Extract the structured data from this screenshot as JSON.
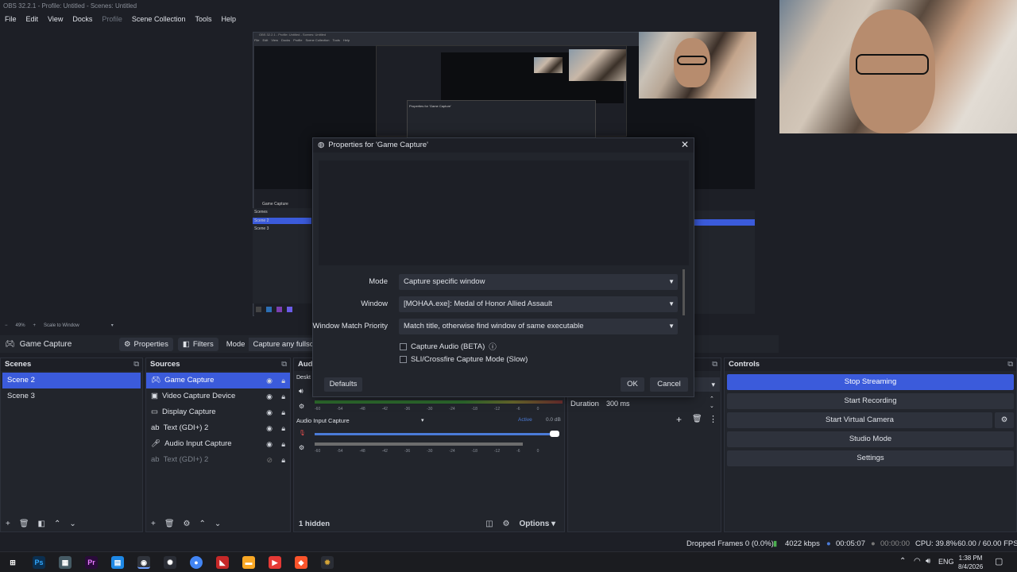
{
  "window": {
    "title": "OBS 32.2.1 - Profile: Untitled - Scenes: Untitled"
  },
  "menu": [
    "File",
    "Edit",
    "View",
    "Docks",
    "Profile",
    "Scene Collection",
    "Tools",
    "Help"
  ],
  "preview": {
    "zoom": "49%",
    "scale": "Scale to Window",
    "nested": {
      "title": "OBS 32.2.1 - Profile: Untitled - Scenes: Untitled",
      "menu": [
        "File",
        "Edit",
        "View",
        "Docks",
        "Profile",
        "Scene Collection",
        "Tools",
        "Help"
      ],
      "dialog_title": "Properties for 'Game Capture'",
      "source": "Game Capture",
      "scenes_header": "Scenes",
      "scenes": [
        "Scene 2",
        "Scene 3"
      ]
    }
  },
  "source_toolbar": {
    "source_name": "Game Capture",
    "properties_label": "Properties",
    "filters_label": "Filters",
    "mode_label": "Mode",
    "mode_value": "Capture any fullscre"
  },
  "scenes": {
    "header": "Scenes",
    "items": [
      "Scene 2",
      "Scene 3"
    ]
  },
  "sources": {
    "header": "Sources",
    "items": [
      {
        "name": "Game Capture",
        "icon": "gamepad-icon"
      },
      {
        "name": "Video Capture Device",
        "icon": "camera-icon"
      },
      {
        "name": "Display Capture",
        "icon": "monitor-icon"
      },
      {
        "name": "Text (GDI+) 2",
        "icon": "text-icon"
      },
      {
        "name": "Audio Input Capture",
        "icon": "mic-icon"
      },
      {
        "name": "Text (GDI+) 2",
        "icon": "text-icon"
      }
    ]
  },
  "audio": {
    "header": "Audi",
    "desktop_label": "Deskt",
    "input_name": "Audio Input Capture",
    "input_status": "Active",
    "input_db": "0.0 dB",
    "ticks": [
      "-60",
      "-54",
      "-48",
      "-42",
      "-36",
      "-30",
      "-24",
      "-18",
      "-12",
      "-6",
      "0"
    ],
    "hidden_label": "1 hidden",
    "options_label": "Options"
  },
  "transitions": {
    "duration_label": "Duration",
    "duration_value": "300 ms"
  },
  "controls": {
    "header": "Controls",
    "stop_streaming": "Stop Streaming",
    "start_recording": "Start Recording",
    "start_virtual_camera": "Start Virtual Camera",
    "studio_mode": "Studio Mode",
    "settings": "Settings"
  },
  "dialog": {
    "title": "Properties for 'Game Capture'",
    "mode_label": "Mode",
    "mode_value": "Capture specific window",
    "window_label": "Window",
    "window_value": "[MOHAA.exe]: Medal of Honor Allied Assault",
    "priority_label": "Window Match Priority",
    "priority_value": "Match title, otherwise find window of same executable",
    "capture_audio_label": "Capture Audio (BETA)",
    "sli_label": "SLI/Crossfire Capture Mode (Slow)",
    "defaults_label": "Defaults",
    "ok_label": "OK",
    "cancel_label": "Cancel"
  },
  "status": {
    "dropped_frames": "Dropped Frames 0 (0.0%)",
    "bitrate": "4022 kbps",
    "stream_time": "00:05:07",
    "rec_time": "00:00:00",
    "cpu": "CPU: 39.8%",
    "fps": "60.00 / 60.00 FPS"
  },
  "taskbar": {
    "lang": "ENG",
    "time": "1:38 PM",
    "date": "8/4/2026"
  },
  "colors": {
    "accent": "#3b5bdb",
    "background": "#1d1f26",
    "panel": "#22252c"
  }
}
